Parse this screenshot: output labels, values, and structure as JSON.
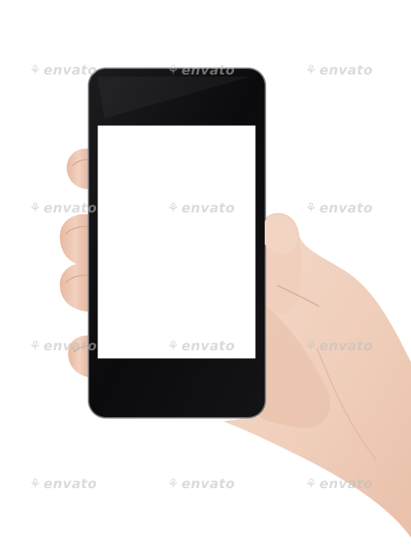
{
  "image": {
    "subject": "hand-holding-smartphone",
    "background_color": "#ffffff",
    "phone_body_color": "#0c0c0e",
    "phone_bezel_color": "#1a1a1c",
    "phone_frame_color": "#7a7c80",
    "screen_color": "#ffffff",
    "skin_color": "#f2d3c1",
    "skin_shadow_color": "#d9a994"
  },
  "watermark": {
    "text": "envato",
    "icon": "envato-leaf-icon"
  }
}
